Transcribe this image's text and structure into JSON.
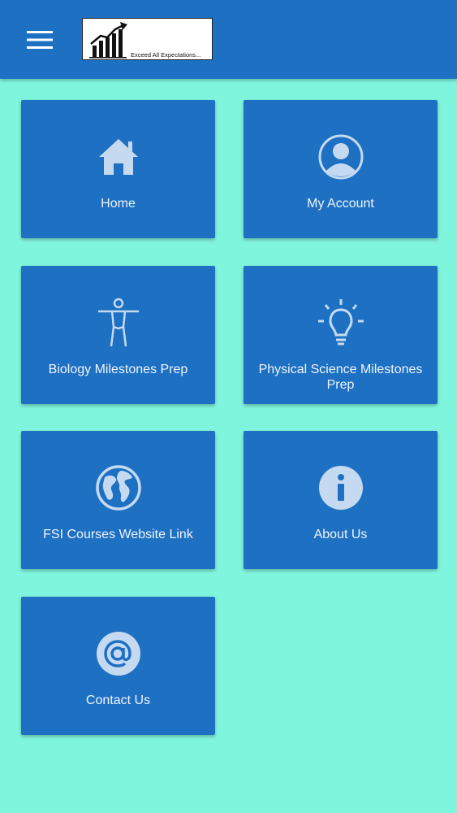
{
  "header": {
    "logo_text": "Exceed All Expectations..."
  },
  "tiles": [
    {
      "label": "Home",
      "icon": "home-icon"
    },
    {
      "label": "My Account",
      "icon": "account-icon"
    },
    {
      "label": "Biology Milestones Prep",
      "icon": "human-body-icon"
    },
    {
      "label": "Physical Science Milestones Prep",
      "icon": "lightbulb-icon"
    },
    {
      "label": "FSI Courses Website Link",
      "icon": "globe-icon"
    },
    {
      "label": "About Us",
      "icon": "info-icon"
    },
    {
      "label": "Contact Us",
      "icon": "at-sign-icon"
    }
  ],
  "colors": {
    "background": "#80f5de",
    "primary": "#1e70c3",
    "icon": "#c5daf1"
  }
}
